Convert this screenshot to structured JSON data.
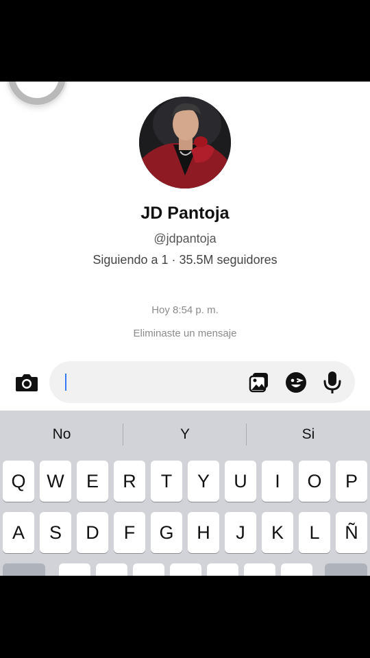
{
  "profile": {
    "name": "JD Pantoja",
    "handle": "@jdpantoja",
    "stats": "Siguiendo a 1 · 35.5M seguidores"
  },
  "chat": {
    "timestamp": "Hoy 8:54 p. m.",
    "system_message": "Eliminaste un mensaje"
  },
  "composer": {
    "input_value": "",
    "icons": {
      "camera": "camera-icon",
      "gallery": "image-icon",
      "emoji": "emoji-icon",
      "mic": "microphone-icon"
    }
  },
  "keyboard": {
    "suggestions": [
      "No",
      "Y",
      "Si"
    ],
    "row1": [
      "Q",
      "W",
      "E",
      "R",
      "T",
      "Y",
      "U",
      "I",
      "O",
      "P"
    ],
    "row2": [
      "A",
      "S",
      "D",
      "F",
      "G",
      "H",
      "J",
      "K",
      "L",
      "Ñ"
    ]
  },
  "colors": {
    "caret": "#3478f6",
    "keyboard_bg": "#d1d3d9",
    "input_bg": "#f1f1f2"
  }
}
